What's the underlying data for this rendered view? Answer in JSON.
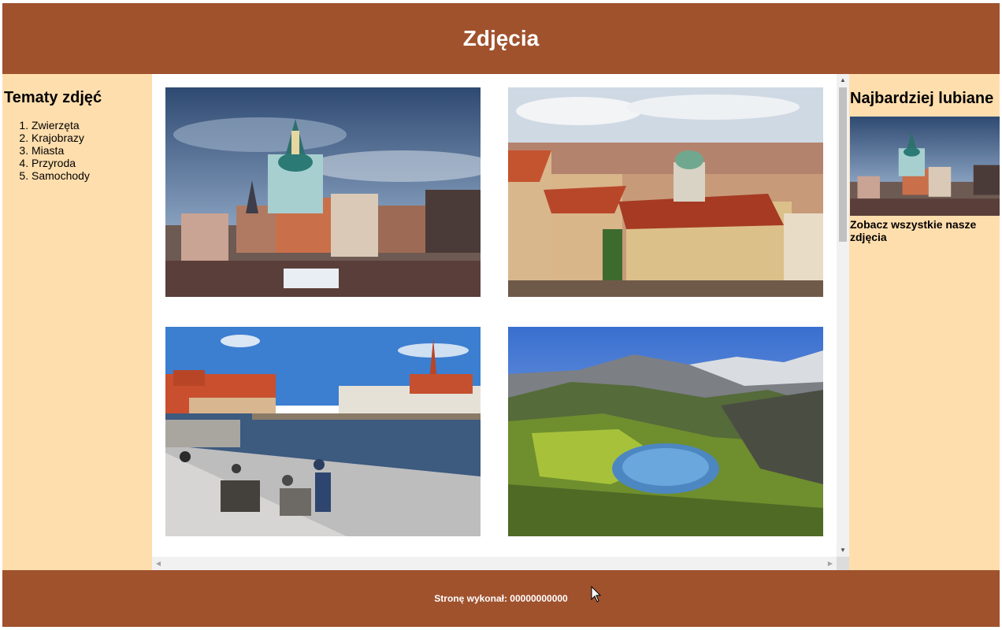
{
  "header": {
    "title": "Zdjęcia"
  },
  "left": {
    "heading": "Tematy zdjęć",
    "topics": [
      "Zwierzęta",
      "Krajobrazy",
      "Miasta",
      "Przyroda",
      "Samochody"
    ]
  },
  "gallery": {
    "photos": [
      {
        "icon": "kyiv-church-cityscape-photo"
      },
      {
        "icon": "prague-rooftops-cityscape-photo"
      },
      {
        "icon": "wroclaw-riverside-photo"
      },
      {
        "icon": "mountain-lake-landscape-photo"
      }
    ]
  },
  "right": {
    "heading": "Najbardziej lubiane",
    "link": "Zobacz wszystkie nasze zdjęcia"
  },
  "footer": {
    "text": "Stronę wykonał: 00000000000"
  },
  "colors": {
    "brand": "#a0522d",
    "panel": "#ffdead"
  }
}
